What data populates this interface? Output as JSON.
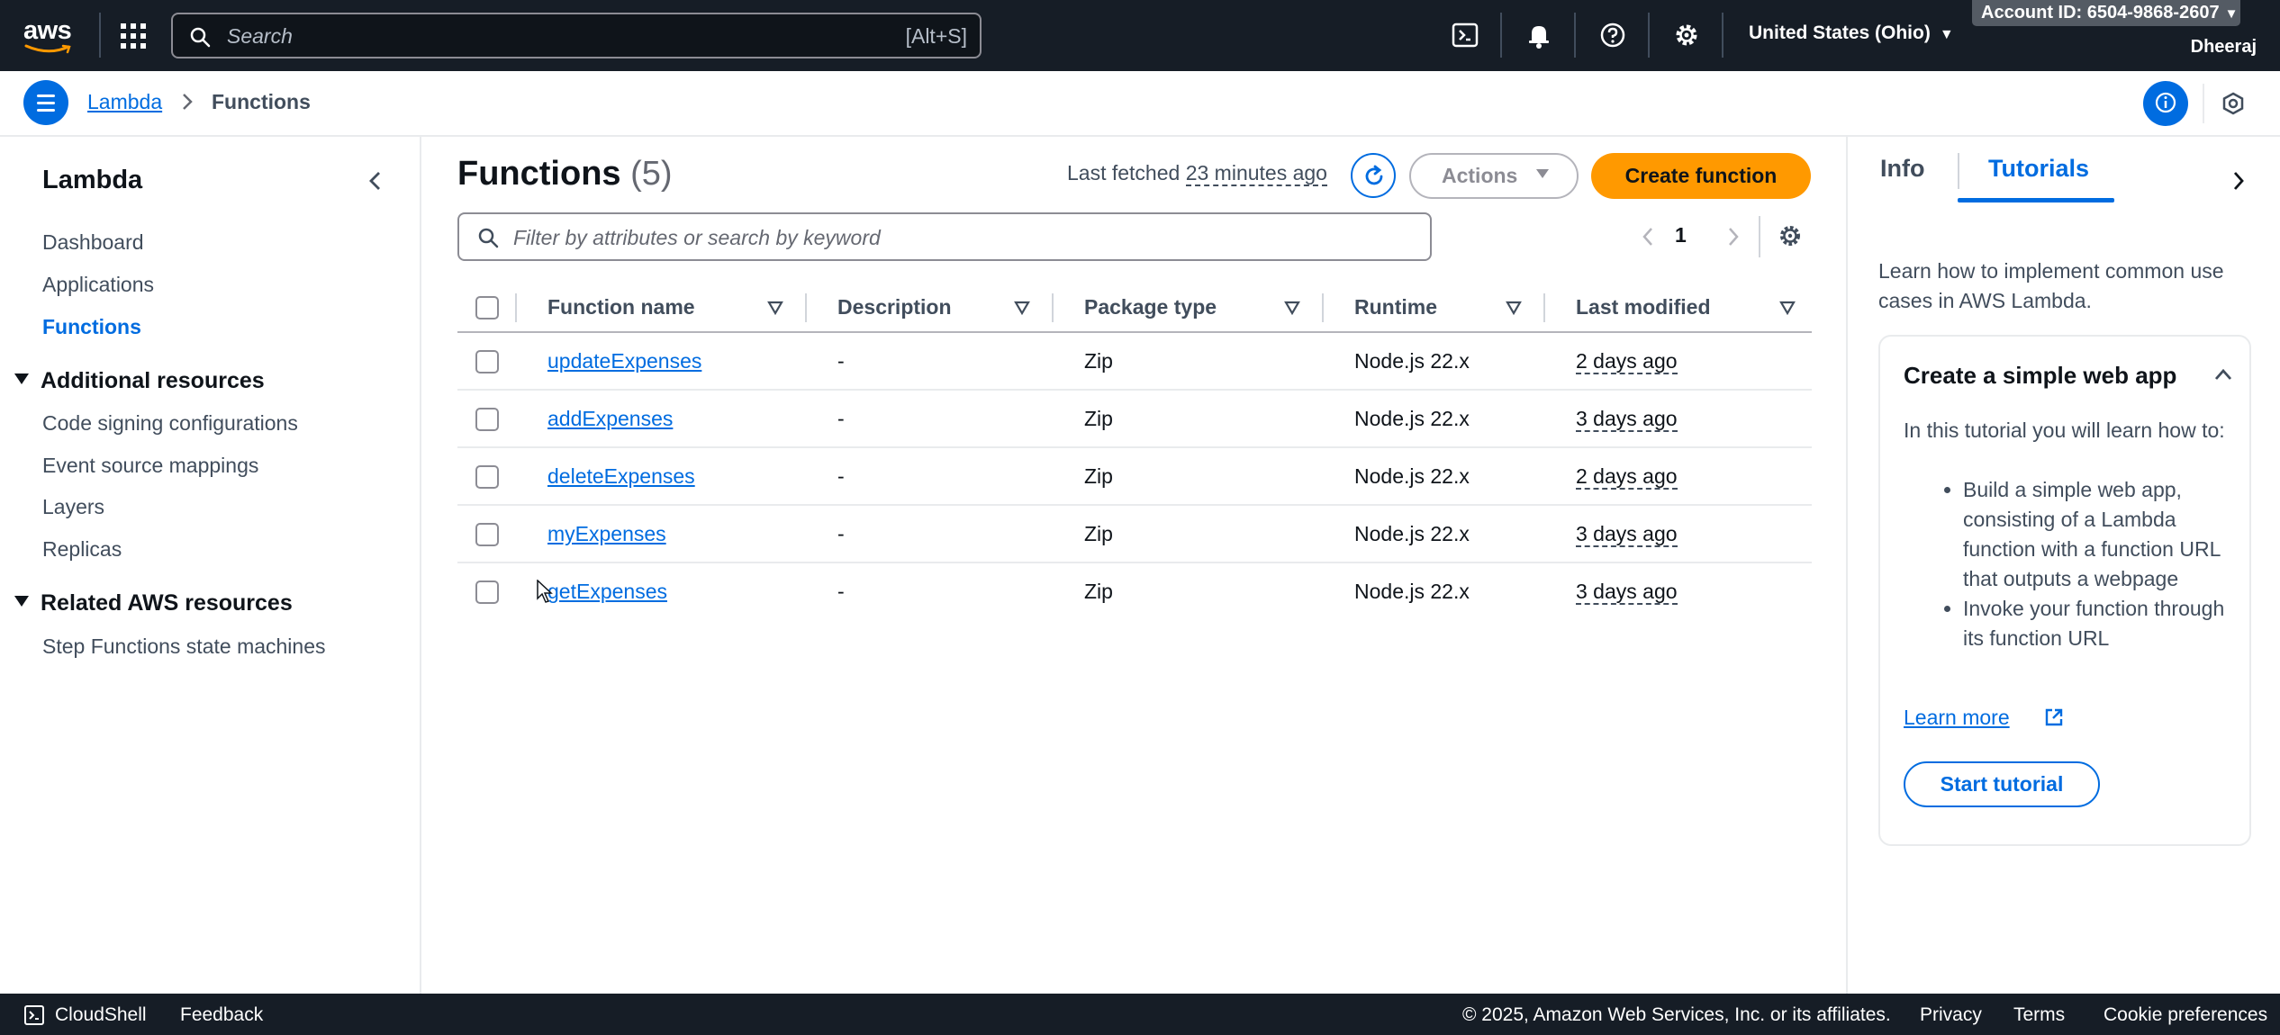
{
  "topnav": {
    "logo_text": "aws",
    "search_placeholder": "Search",
    "search_shortcut": "[Alt+S]",
    "region": "United States (Ohio)",
    "account": "Account ID: 6504-9868-2607",
    "user": "Dheeraj"
  },
  "breadcrumb": {
    "parent": "Lambda",
    "current": "Functions"
  },
  "sidebar": {
    "title": "Lambda",
    "items": [
      {
        "label": "Dashboard"
      },
      {
        "label": "Applications"
      },
      {
        "label": "Functions"
      }
    ],
    "additional_title": "Additional resources",
    "additional_items": [
      {
        "label": "Code signing configurations"
      },
      {
        "label": "Event source mappings"
      },
      {
        "label": "Layers"
      },
      {
        "label": "Replicas"
      }
    ],
    "related_title": "Related AWS resources",
    "related_items": [
      {
        "label": "Step Functions state machines"
      }
    ]
  },
  "main": {
    "heading": "Functions",
    "count": "(5)",
    "last_fetched_prefix": "Last fetched",
    "last_fetched_ago": "23 minutes ago",
    "actions_label": "Actions",
    "create_label": "Create function",
    "filter_placeholder": "Filter by attributes or search by keyword",
    "page": "1",
    "columns": [
      "Function name",
      "Description",
      "Package type",
      "Runtime",
      "Last modified"
    ],
    "rows": [
      {
        "name": "updateExpenses",
        "description": "-",
        "package": "Zip",
        "runtime": "Node.js 22.x",
        "modified": "2 days ago"
      },
      {
        "name": "addExpenses",
        "description": "-",
        "package": "Zip",
        "runtime": "Node.js 22.x",
        "modified": "3 days ago"
      },
      {
        "name": "deleteExpenses",
        "description": "-",
        "package": "Zip",
        "runtime": "Node.js 22.x",
        "modified": "2 days ago"
      },
      {
        "name": "myExpenses",
        "description": "-",
        "package": "Zip",
        "runtime": "Node.js 22.x",
        "modified": "3 days ago"
      },
      {
        "name": "getExpenses",
        "description": "-",
        "package": "Zip",
        "runtime": "Node.js 22.x",
        "modified": "3 days ago"
      }
    ]
  },
  "tools": {
    "tab_info": "Info",
    "tab_tutorials": "Tutorials",
    "intro": "Learn how to implement common use cases in AWS Lambda.",
    "card_title": "Create a simple web app",
    "card_intro": "In this tutorial you will learn how to:",
    "bullets": [
      "Build a simple web app, consisting of a Lambda function with a function URL that outputs a webpage",
      "Invoke your function through its function URL"
    ],
    "learn_more": "Learn more",
    "start_label": "Start tutorial"
  },
  "footer": {
    "cloudshell": "CloudShell",
    "feedback": "Feedback",
    "copyright": "© 2025, Amazon Web Services, Inc. or its affiliates.",
    "privacy": "Privacy",
    "terms": "Terms",
    "cookies": "Cookie preferences"
  },
  "colors": {
    "nav_bg": "#161d26",
    "link": "#006ce0",
    "primary_button": "#ff9900"
  },
  "icons": [
    "aws-logo",
    "apps-grid-icon",
    "search-icon",
    "cloudshell-icon",
    "bell-icon",
    "help-icon",
    "settings-icon",
    "menu-icon",
    "chevron-right-icon",
    "info-icon",
    "hexagon-icon",
    "chevron-left-icon",
    "caret-down-icon",
    "refresh-icon",
    "sort-icon",
    "external-link-icon",
    "chevron-up-icon"
  ]
}
